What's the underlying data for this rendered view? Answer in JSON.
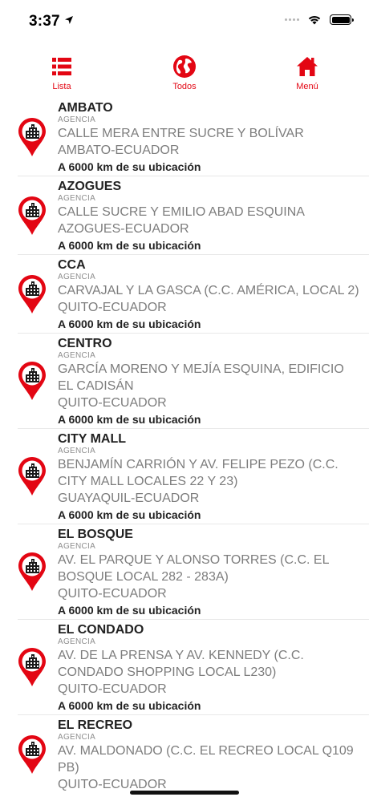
{
  "status_bar": {
    "time": "3:37"
  },
  "toolbar": {
    "list_label": "Lista",
    "all_label": "Todos",
    "menu_label": "Menú",
    "accent": "#e30613"
  },
  "agencies": [
    {
      "name": "AMBATO",
      "type": "AGENCIA",
      "address": "CALLE MERA ENTRE SUCRE Y BOLÍVAR",
      "city": "AMBATO-ECUADOR",
      "distance": "A 6000 km de su ubicación"
    },
    {
      "name": "AZOGUES",
      "type": "AGENCIA",
      "address": "CALLE SUCRE Y EMILIO ABAD ESQUINA",
      "city": "AZOGUES-ECUADOR",
      "distance": "A 6000 km de su ubicación"
    },
    {
      "name": "CCA",
      "type": "AGENCIA",
      "address": "CARVAJAL Y LA GASCA (C.C. AMÉRICA, LOCAL 2)",
      "city": "QUITO-ECUADOR",
      "distance": "A 6000 km de su ubicación"
    },
    {
      "name": "CENTRO",
      "type": "AGENCIA",
      "address": "GARCÍA MORENO Y MEJÍA ESQUINA, EDIFICIO EL CADISÁN",
      "city": "QUITO-ECUADOR",
      "distance": "A 6000 km de su ubicación"
    },
    {
      "name": "CITY MALL",
      "type": "AGENCIA",
      "address": "BENJAMÍN CARRIÓN Y AV. FELIPE PEZO (C.C. CITY MALL LOCALES 22 Y 23)",
      "city": "GUAYAQUIL-ECUADOR",
      "distance": "A 6000 km de su ubicación"
    },
    {
      "name": "EL BOSQUE",
      "type": "AGENCIA",
      "address": "AV. EL PARQUE Y ALONSO TORRES (C.C. EL BOSQUE LOCAL 282 - 283A)",
      "city": "QUITO-ECUADOR",
      "distance": "A 6000 km de su ubicación"
    },
    {
      "name": "EL CONDADO",
      "type": "AGENCIA",
      "address": "AV. DE LA PRENSA Y AV. KENNEDY (C.C. CONDADO SHOPPING LOCAL L230)",
      "city": "QUITO-ECUADOR",
      "distance": "A 6000 km de su ubicación"
    },
    {
      "name": "EL RECREO",
      "type": "AGENCIA",
      "address": "AV. MALDONADO (C.C. EL RECREO LOCAL Q109 PB)",
      "city": "QUITO-ECUADOR",
      "distance": ""
    }
  ]
}
